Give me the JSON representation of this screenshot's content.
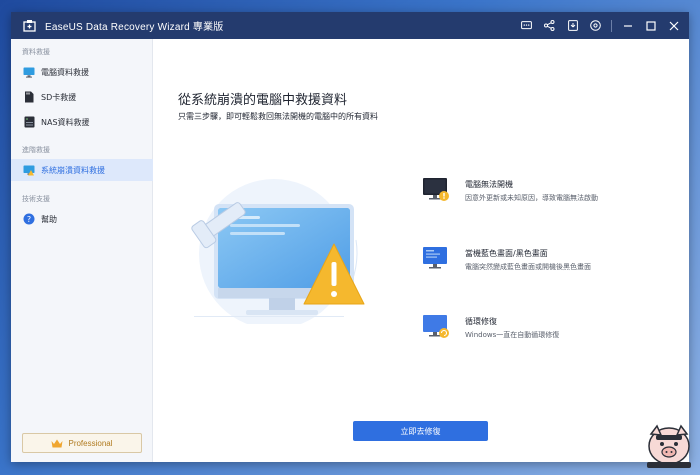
{
  "window": {
    "title": "EaseUS Data Recovery Wizard 專業版",
    "controls": [
      "feedback-icon",
      "share-icon",
      "info-icon",
      "settings-icon",
      "minimize-icon",
      "maximize-icon",
      "close-icon"
    ]
  },
  "sidebar": {
    "sections": [
      {
        "label": "資料救援",
        "items": [
          {
            "label": "電腦資料救援",
            "icon": "monitor-icon"
          },
          {
            "label": "SD卡救援",
            "icon": "sd-card-icon"
          },
          {
            "label": "NAS資料救援",
            "icon": "nas-icon"
          }
        ]
      },
      {
        "label": "進階救援",
        "items": [
          {
            "label": "系統崩潰資料救援",
            "icon": "crash-pc-icon",
            "active": true
          }
        ]
      },
      {
        "label": "技術支援",
        "items": [
          {
            "label": "幫助",
            "icon": "help-icon"
          }
        ]
      }
    ],
    "pro_label": "Professional"
  },
  "main": {
    "title": "從系統崩潰的電腦中救援資料",
    "subtitle": "只需三步驟，即可輕鬆救回無法開機的電腦中的所有資料",
    "features": [
      {
        "title": "電腦無法開機",
        "desc": "因意外更新或未知原因，導致電腦無法啟動",
        "icon": "black-screen-warning-icon"
      },
      {
        "title": "當機藍色畫面/黑色畫面",
        "desc": "電腦突然變成藍色畫面或開機後黑色畫面",
        "icon": "blue-screen-icon"
      },
      {
        "title": "循環修復",
        "desc": "Windows一直在自動循環修復",
        "icon": "repair-loop-icon"
      }
    ],
    "button_label": "立即去修復"
  },
  "colors": {
    "titlebar": "#243b6e",
    "accent": "#2f6fe0",
    "active_bg": "#dde8fb",
    "warning": "#f5b82e"
  }
}
